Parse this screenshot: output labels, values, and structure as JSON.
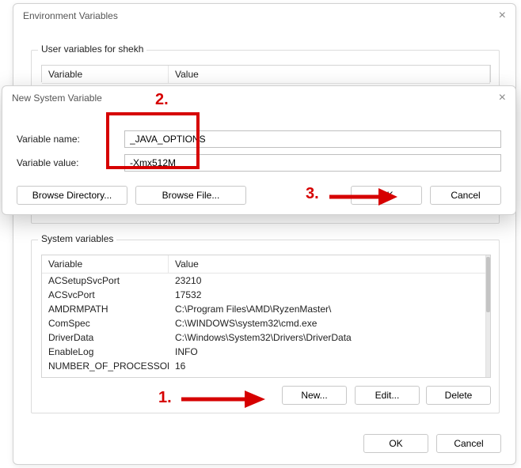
{
  "envWin": {
    "title": "Environment Variables",
    "userGroup": "User variables for shekh",
    "sysGroup": "System variables",
    "colVariable": "Variable",
    "colValue": "Value",
    "sysRows": [
      {
        "var": "ACSetupSvcPort",
        "val": "23210"
      },
      {
        "var": "ACSvcPort",
        "val": "17532"
      },
      {
        "var": "AMDRMPATH",
        "val": "C:\\Program Files\\AMD\\RyzenMaster\\"
      },
      {
        "var": "ComSpec",
        "val": "C:\\WINDOWS\\system32\\cmd.exe"
      },
      {
        "var": "DriverData",
        "val": "C:\\Windows\\System32\\Drivers\\DriverData"
      },
      {
        "var": "EnableLog",
        "val": "INFO"
      },
      {
        "var": "NUMBER_OF_PROCESSORS",
        "val": "16"
      }
    ],
    "btnNew": "New...",
    "btnEdit": "Edit...",
    "btnDelete": "Delete",
    "btnOK": "OK",
    "btnCancel": "Cancel"
  },
  "newVarWin": {
    "title": "New System Variable",
    "lblName": "Variable name:",
    "lblValue": "Variable value:",
    "valName": "_JAVA_OPTIONS",
    "valValue": "-Xmx512M",
    "btnBrowseDir": "Browse Directory...",
    "btnBrowseFile": "Browse File...",
    "btnOK": "OK",
    "btnCancel": "Cancel"
  },
  "annot": {
    "n1": "1.",
    "n2": "2.",
    "n3": "3."
  }
}
